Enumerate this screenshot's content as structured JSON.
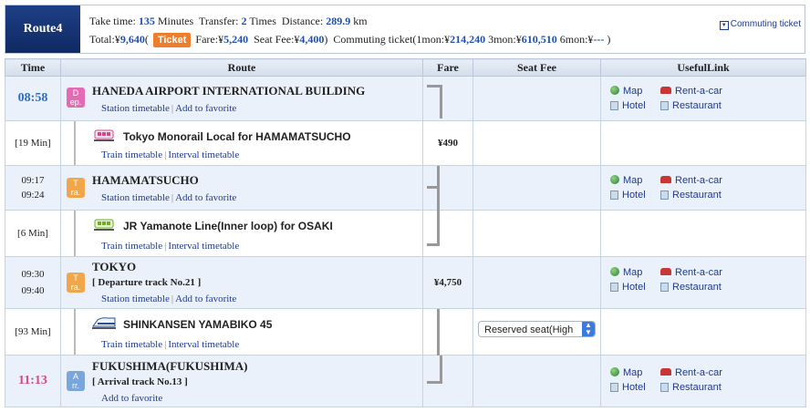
{
  "header": {
    "route_label": "Route4",
    "take_time_label": "Take time:",
    "take_time_value": "135",
    "take_time_unit": "Minutes",
    "transfer_label": "Transfer:",
    "transfer_value": "2",
    "transfer_unit": "Times",
    "distance_label": "Distance:",
    "distance_value": "289.9",
    "distance_unit": "km",
    "total_label": "Total:¥",
    "total_value": "9,640",
    "ticket_button": "Ticket",
    "fare_label": "Fare:¥",
    "fare_value": "5,240",
    "seat_fee_label": "Seat Fee:¥",
    "seat_fee_value": "4,400",
    "commuting_label": "Commuting ticket(1mon:¥",
    "commuting_1mon": "214,240",
    "commuting_3mon_label": "3mon:¥",
    "commuting_3mon": "610,510",
    "commuting_6mon_label": "6mon:¥",
    "commuting_6mon": "---",
    "commuting_close": ")",
    "commuting_ticket_link": "Commuting ticket"
  },
  "table": {
    "headers": {
      "time": "Time",
      "route": "Route",
      "fare": "Fare",
      "seat_fee": "Seat Fee",
      "useful_link": "UsefulLink"
    },
    "links": {
      "station_timetable": "Station timetable",
      "add_to_favorite": "Add to favorite",
      "train_timetable": "Train timetable",
      "interval_timetable": "Interval timetable",
      "map": "Map",
      "rent_a_car": "Rent-a-car",
      "hotel": "Hotel",
      "restaurant": "Restaurant",
      "separator": "|"
    },
    "stations": [
      {
        "time": "08:58",
        "badge": "Dep.",
        "name": "HANEDA AIRPORT INTERNATIONAL BUILDING"
      },
      {
        "time1": "09:17",
        "time2": "09:24",
        "badge": "Tra.",
        "name": "HAMAMATSUCHO"
      },
      {
        "time1": "09:30",
        "time2": "09:40",
        "badge": "Tra.",
        "name": "TOKYO",
        "track": "[ Departure track No.21 ]"
      },
      {
        "time": "11:13",
        "badge": "Arr.",
        "name": "FUKUSHIMA(FUKUSHIMA)",
        "track": "[ Arrival track No.13 ]"
      }
    ],
    "segments": [
      {
        "duration": "[19 Min]",
        "line": "Tokyo Monorail Local  for HAMAMATSUCHO",
        "fare": "¥490"
      },
      {
        "duration": "[6 Min]",
        "line": "JR Yamanote Line(Inner loop)  for OSAKI",
        "fare": "¥4,750"
      },
      {
        "duration": "[93 Min]",
        "line": "SHINKANSEN YAMABIKO 45",
        "seat_select": "Reserved seat(High"
      }
    ]
  },
  "colors": {
    "route_badge": "#163677",
    "dep_badge": "#e46ab5",
    "transfer_badge": "#f2a64a",
    "arr_badge": "#7aa6d9",
    "dep_time": "#2e6bc1",
    "arr_time": "#e0458a",
    "ticket_button": "#ef7d2e"
  },
  "icons": [
    "globe-icon",
    "car-icon",
    "hotel-icon",
    "restaurant-icon",
    "monorail-icon",
    "train-icon",
    "shinkansen-icon",
    "commuting-ticket-icon"
  ]
}
